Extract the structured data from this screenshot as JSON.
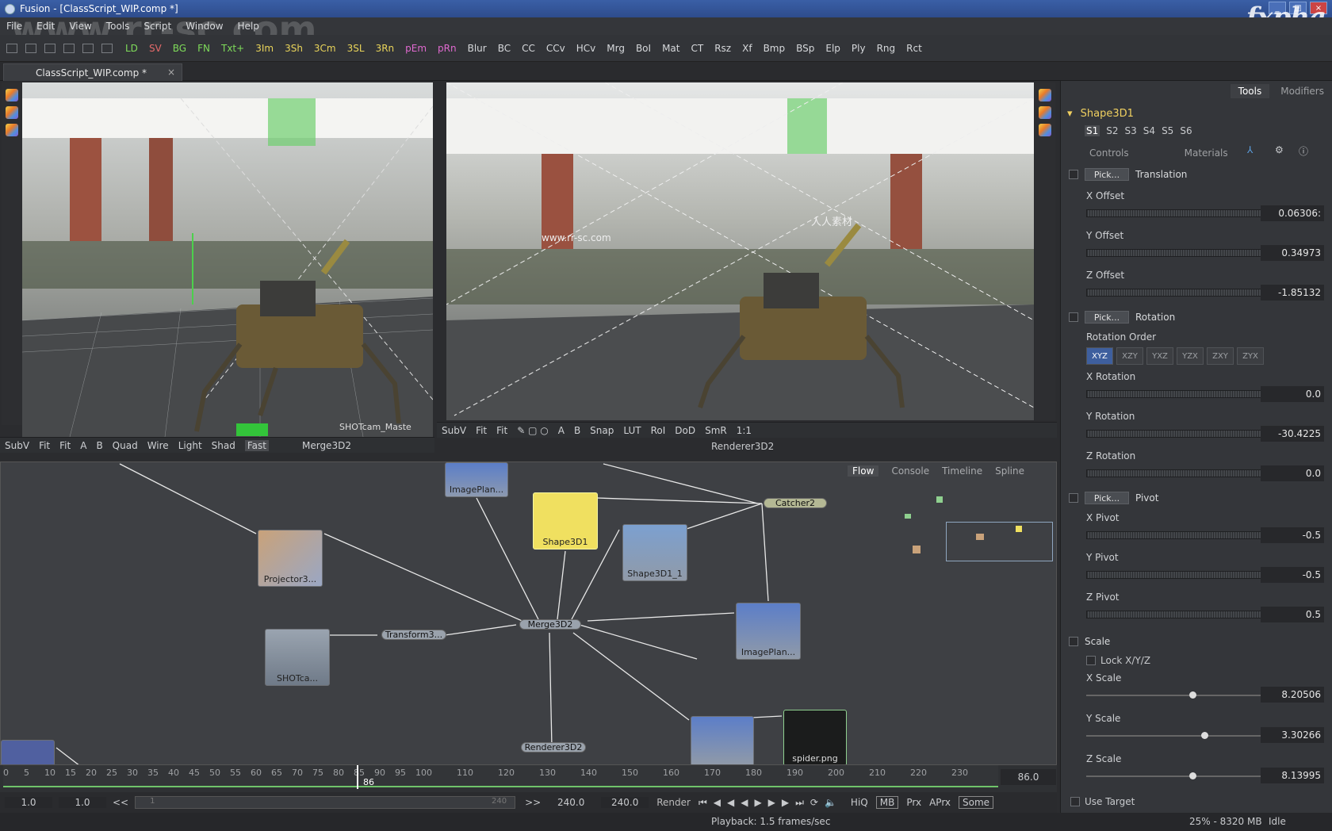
{
  "window": {
    "title": "Fusion - [ClassScript_WIP.comp *]"
  },
  "menu": [
    "File",
    "Edit",
    "View",
    "Tools",
    "Script",
    "Window",
    "Help"
  ],
  "toolbar": {
    "tools": [
      "LD",
      "SV",
      "BG",
      "FN",
      "Txt+",
      "3Im",
      "3Sh",
      "3Cm",
      "3SL",
      "3Rn",
      "pEm",
      "pRn",
      "Blur",
      "BC",
      "CC",
      "CCv",
      "HCv",
      "Mrg",
      "BoI",
      "Mat",
      "CT",
      "Rsz",
      "Xf",
      "Bmp",
      "BSp",
      "Elp",
      "Ply",
      "Rng",
      "Rct"
    ],
    "tool_colors": {
      "LD": "#7fdc5a",
      "SV": "#e46a6a",
      "BG": "#7fdc5a",
      "FN": "#7fdc5a",
      "Txt+": "#7fdc5a",
      "3Im": "#e9d45a",
      "3Sh": "#e9d45a",
      "3Cm": "#e9d45a",
      "3SL": "#e9d45a",
      "3Rn": "#e9d45a",
      "pEm": "#e06ad0",
      "pRn": "#e06ad0"
    }
  },
  "doc_tab": {
    "label": "ClassScript_WIP.comp *",
    "close": "×"
  },
  "viewer_left": {
    "bar": [
      "SubV",
      "Fit",
      "Fit",
      "A",
      "B",
      "Quad",
      "Wire",
      "Light",
      "Shad",
      "Fast"
    ],
    "node": "Merge3D2",
    "overlay": "SHOTcam_Maste"
  },
  "viewer_right": {
    "bar": [
      "SubV",
      "Fit",
      "Fit",
      "A",
      "B",
      "Snap",
      "LUT",
      "RoI",
      "DoD",
      "SmR",
      "1:1"
    ],
    "node": "Renderer3D2"
  },
  "watermarks": {
    "top": "www.rr-sc.com",
    "mid": "www.rr-sc.com",
    "cn": "人人素材"
  },
  "flow": {
    "tabs": [
      "Flow",
      "Console",
      "Timeline",
      "Spline"
    ],
    "nodes": {
      "projector": "Projector3...",
      "shape3d1": "Shape3D1",
      "shape3d1_1": "Shape3D1_1",
      "imageplane_top": "ImagePlan...",
      "imageplane_right": "ImagePlan...",
      "shotcam": "SHOTca...",
      "spiderpng": "spider.png",
      "transform": "Transform3...",
      "merge": "Merge3D2",
      "catcher": "Catcher2",
      "renderer": "Renderer3D2"
    }
  },
  "timeline": {
    "ticks": [
      "0",
      "5",
      "10",
      "15",
      "20",
      "25",
      "30",
      "35",
      "40",
      "45",
      "50",
      "55",
      "60",
      "65",
      "70",
      "75",
      "80",
      "85",
      "90",
      "95",
      "100",
      "110",
      "120",
      "130",
      "140",
      "150",
      "160",
      "170",
      "180",
      "190",
      "200",
      "210",
      "220",
      "230"
    ],
    "current": "86",
    "end_field": "86.0"
  },
  "transport": {
    "start_a": "1.0",
    "start_b": "1.0",
    "rew": "<<",
    "scrub_left": "1",
    "scrub_right": "240",
    "ff": ">>",
    "end_a": "240.0",
    "end_b": "240.0",
    "render": "Render",
    "hiq": "HiQ",
    "mb": "MB",
    "prx": "Prx",
    "aprx": "APrx",
    "some": "Some"
  },
  "status": {
    "playback": "Playback: 1.5 frames/sec",
    "mem": "25% - 8320 MB",
    "state": "Idle"
  },
  "inspector": {
    "tabs": [
      "Tools",
      "Modifiers"
    ],
    "tool": "Shape3D1",
    "slots": [
      "S1",
      "S2",
      "S3",
      "S4",
      "S5",
      "S6"
    ],
    "subtabs": [
      "Controls",
      "Materials"
    ],
    "translation": {
      "pick": "Pick...",
      "title": "Translation",
      "x_label": "X Offset",
      "x": "0.06306:",
      "y_label": "Y Offset",
      "y": "0.34973",
      "z_label": "Z Offset",
      "z": "-1.85132"
    },
    "rotation": {
      "pick": "Pick...",
      "title": "Rotation",
      "order_label": "Rotation Order",
      "orders": [
        "XYZ",
        "XZY",
        "YXZ",
        "YZX",
        "ZXY",
        "ZYX"
      ],
      "x_label": "X Rotation",
      "x": "0.0",
      "y_label": "Y Rotation",
      "y": "-30.4225",
      "z_label": "Z Rotation",
      "z": "0.0"
    },
    "pivot": {
      "pick": "Pick...",
      "title": "Pivot",
      "x_label": "X Pivot",
      "x": "-0.5",
      "y_label": "Y Pivot",
      "y": "-0.5",
      "z_label": "Z Pivot",
      "z": "0.5"
    },
    "scale": {
      "title": "Scale",
      "lock": "Lock X/Y/Z",
      "x_label": "X Scale",
      "x": "8.20506",
      "y_label": "Y Scale",
      "y": "3.30266",
      "z_label": "Z Scale",
      "z": "8.13995"
    },
    "use_target": "Use Target"
  },
  "logo": "fxpha"
}
